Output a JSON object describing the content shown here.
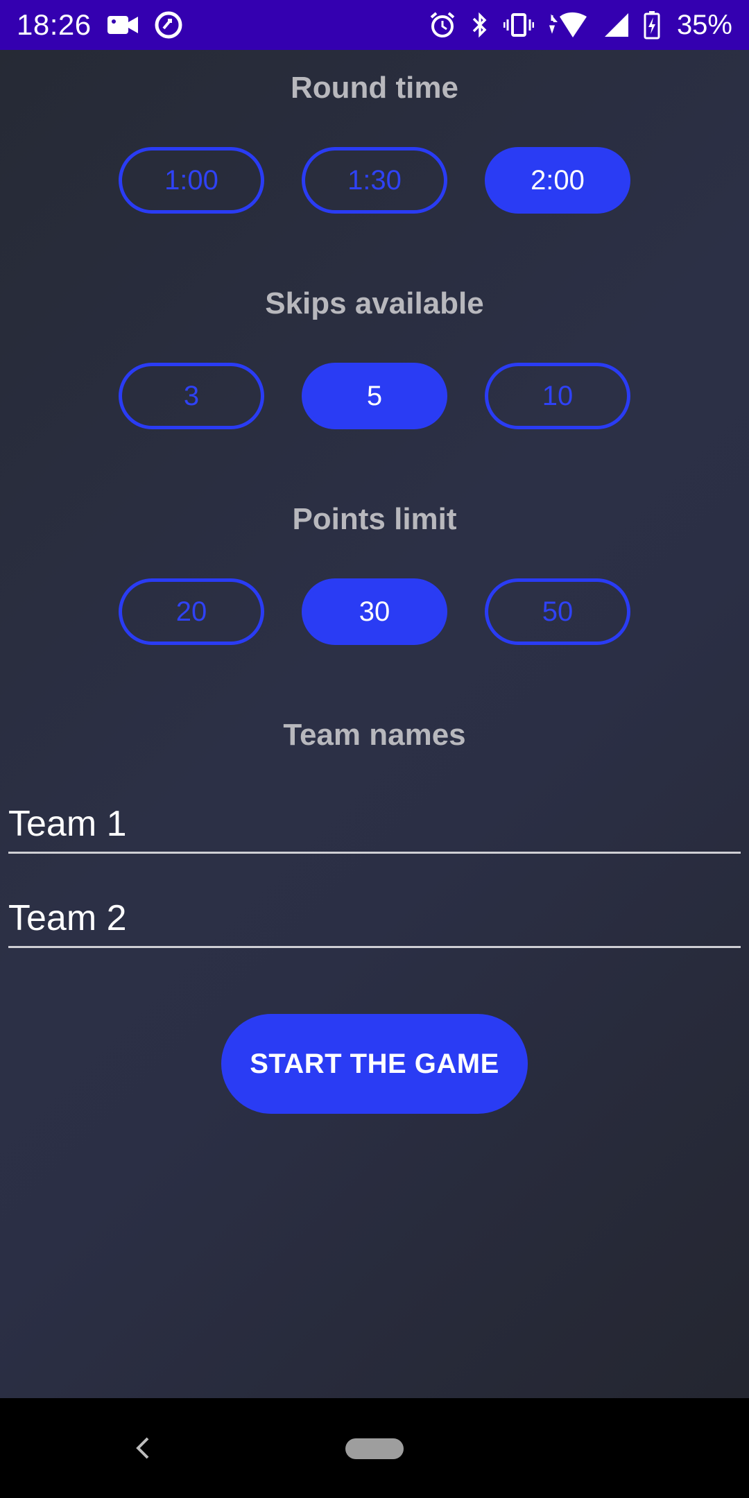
{
  "status_bar": {
    "time": "18:26",
    "battery_percent": "35%",
    "icons": [
      "video-camera-icon",
      "sync-icon",
      "alarm-icon",
      "bluetooth-icon",
      "vibrate-icon",
      "wifi-icon",
      "cell-signal-icon",
      "battery-charging-icon"
    ]
  },
  "round_time": {
    "title": "Round time",
    "options": [
      "1:00",
      "1:30",
      "2:00"
    ],
    "selected": "2:00"
  },
  "skips": {
    "title": "Skips available",
    "options": [
      "3",
      "5",
      "10"
    ],
    "selected": "5"
  },
  "points": {
    "title": "Points limit",
    "options": [
      "20",
      "30",
      "50"
    ],
    "selected": "30"
  },
  "teams": {
    "title": "Team names",
    "team1_value": "Team 1",
    "team2_value": "Team 2"
  },
  "start_button_label": "START THE GAME",
  "colors": {
    "accent": "#2a3cf4",
    "status_bar": "#3400b0",
    "title_text": "#b8b8bd"
  }
}
